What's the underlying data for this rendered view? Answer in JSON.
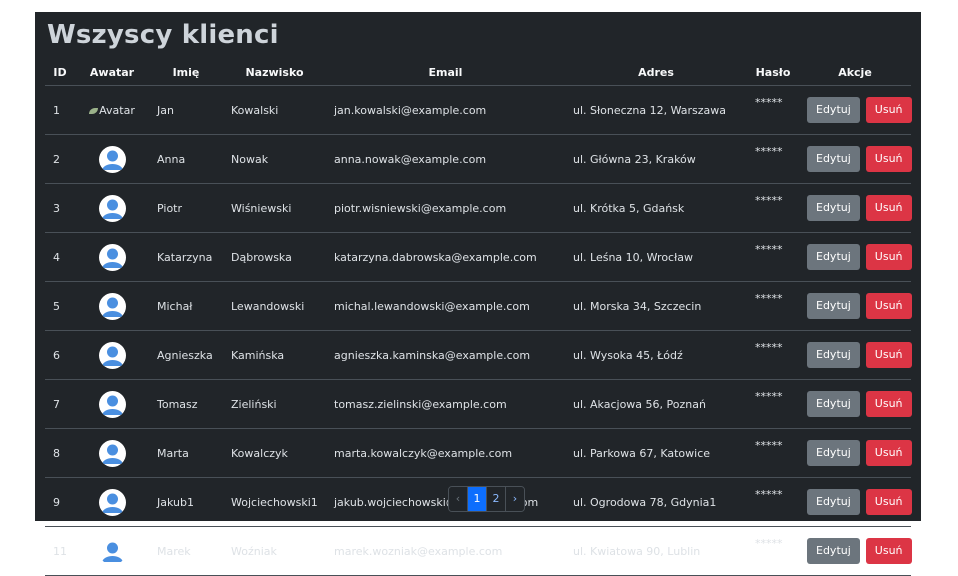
{
  "page": {
    "title": "Wszyscy klienci"
  },
  "table": {
    "headers": [
      "ID",
      "Awatar",
      "Imię",
      "Nazwisko",
      "Email",
      "Adres",
      "Hasło",
      "Akcje"
    ],
    "rows": [
      {
        "id": "1",
        "avatar_alt": "Avatar",
        "first": "Jan",
        "last": "Kowalski",
        "email": "jan.kowalski@example.com",
        "address": "ul. Słoneczna 12, Warszawa",
        "password": "*****"
      },
      {
        "id": "2",
        "avatar_alt": "",
        "first": "Anna",
        "last": "Nowak",
        "email": "anna.nowak@example.com",
        "address": "ul. Główna 23, Kraków",
        "password": "*****"
      },
      {
        "id": "3",
        "avatar_alt": "",
        "first": "Piotr",
        "last": "Wiśniewski",
        "email": "piotr.wisniewski@example.com",
        "address": "ul. Krótka 5, Gdańsk",
        "password": "*****"
      },
      {
        "id": "4",
        "avatar_alt": "",
        "first": "Katarzyna",
        "last": "Dąbrowska",
        "email": "katarzyna.dabrowska@example.com",
        "address": "ul. Leśna 10, Wrocław",
        "password": "*****"
      },
      {
        "id": "5",
        "avatar_alt": "",
        "first": "Michał",
        "last": "Lewandowski",
        "email": "michal.lewandowski@example.com",
        "address": "ul. Morska 34, Szczecin",
        "password": "*****"
      },
      {
        "id": "6",
        "avatar_alt": "",
        "first": "Agnieszka",
        "last": "Kamińska",
        "email": "agnieszka.kaminska@example.com",
        "address": "ul. Wysoka 45, Łódź",
        "password": "*****"
      },
      {
        "id": "7",
        "avatar_alt": "",
        "first": "Tomasz",
        "last": "Zieliński",
        "email": "tomasz.zielinski@example.com",
        "address": "ul. Akacjowa 56, Poznań",
        "password": "*****"
      },
      {
        "id": "8",
        "avatar_alt": "",
        "first": "Marta",
        "last": "Kowalczyk",
        "email": "marta.kowalczyk@example.com",
        "address": "ul. Parkowa 67, Katowice",
        "password": "*****"
      },
      {
        "id": "9",
        "avatar_alt": "",
        "first": "Jakub1",
        "last": "Wojciechowski1",
        "email": "jakub.wojciechowski@ex2ample.com",
        "address": "ul. Ogrodowa 78, Gdynia1",
        "password": "*****"
      },
      {
        "id": "11",
        "avatar_alt": "",
        "first": "Marek",
        "last": "Woźniak",
        "email": "marek.wozniak@example.com",
        "address": "ul. Kwiatowa 90, Lublin",
        "password": "*****"
      }
    ],
    "edit_label": "Edytuj",
    "delete_label": "Usuń"
  },
  "pagination": {
    "prev": "‹",
    "pages": [
      "1",
      "2"
    ],
    "active": "1",
    "next": "›"
  },
  "colors": {
    "background": "#212529",
    "edit": "#6c757d",
    "delete": "#dc3545",
    "active_page": "#0d6efd",
    "avatar": "#4a8fe0"
  },
  "icons": {
    "avatar": "user-avatar-icon",
    "broken_image": "broken-image-icon"
  }
}
